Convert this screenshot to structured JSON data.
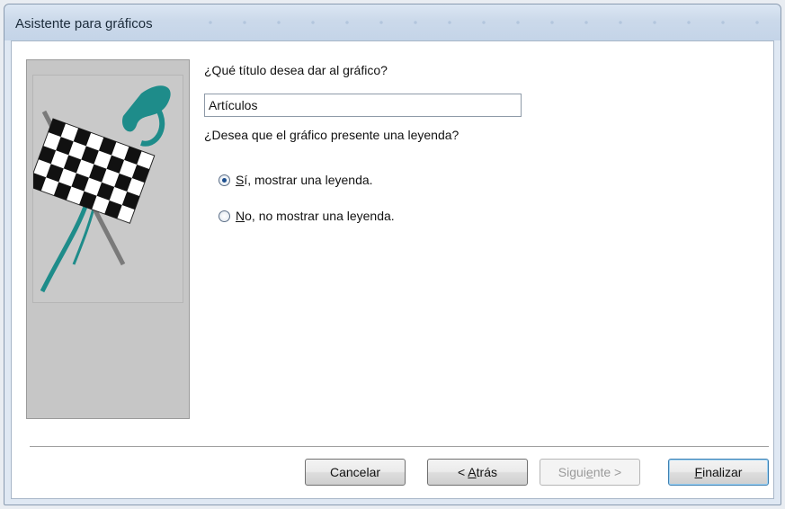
{
  "window": {
    "title": "Asistente para gráficos"
  },
  "form": {
    "title_question": "¿Qué título desea dar al gráfico?",
    "title_value": "Artículos",
    "legend_question": "¿Desea que el gráfico presente una leyenda?",
    "options": [
      {
        "mnemonic": "S",
        "rest": "í, mostrar una leyenda.",
        "checked": true
      },
      {
        "mnemonic": "N",
        "rest": "o, no mostrar una leyenda.",
        "checked": false
      }
    ]
  },
  "buttons": {
    "cancel": "Cancelar",
    "back_prefix": "< ",
    "back_mnemonic": "A",
    "back_rest": "trás",
    "next_prefix": "Sigui",
    "next_mnemonic": "e",
    "next_rest": "nte >",
    "finish_mnemonic": "F",
    "finish_rest": "inalizar"
  },
  "colors": {
    "accent": "#1d4f8f",
    "art_teal": "#1e8c8a",
    "art_bg": "#c6c6c6"
  }
}
